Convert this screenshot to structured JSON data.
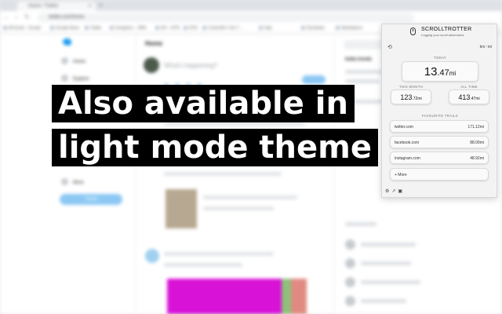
{
  "browser": {
    "tab_title": "Home / Twitter",
    "url": "twitter.com/home",
    "bookmarks": [
      "All Email – Scroptr",
      "Google News",
      "Twitter",
      "Sengaluru – JIRA",
      "AH – ISTN",
      "DOS",
      "Contentful / Get Y…",
      "Sign",
      "Stocktwits",
      "Marketplace"
    ]
  },
  "twitter": {
    "home_title": "Home",
    "composer_placeholder": "What's happening?",
    "nav": [
      "Home",
      "Explore"
    ],
    "more_label": "More",
    "tweet_label": "Tweet",
    "trends_title": "India trends"
  },
  "headline": {
    "line1": "Also available in",
    "line2": "light mode theme"
  },
  "popup": {
    "title": "SCROLLTROTTER",
    "subtitle": "Logging your scroll adventures",
    "unit_km": "km",
    "unit_mi": "mi",
    "today_label": "TODAY",
    "today_value": "13",
    "today_decimal": ".47",
    "today_unit": "mi",
    "month_label": "THIS MONTH",
    "month_value": "123",
    "month_decimal": ".72",
    "month_unit": "mi",
    "alltime_label": "ALL TIME",
    "alltime_value": "413",
    "alltime_decimal": ".47",
    "alltime_unit": "mi",
    "trails_label": "FAVOURITE TRAILS",
    "trails": [
      {
        "site": "twitter.com",
        "distance": "171.12mi"
      },
      {
        "site": "facebook.com",
        "distance": "88.09mi"
      },
      {
        "site": "instagram.com",
        "distance": "48.92mi"
      }
    ],
    "more_label": "+ More"
  },
  "colors": {
    "headline_bg": "#000000",
    "headline_fg": "#ffffff",
    "twitter_blue": "#1d9bf0",
    "popup_bg": "#f3f3f3"
  },
  "icons": [
    "mouse-icon",
    "refresh-icon",
    "settings-icon",
    "share-icon",
    "info-icon"
  ]
}
